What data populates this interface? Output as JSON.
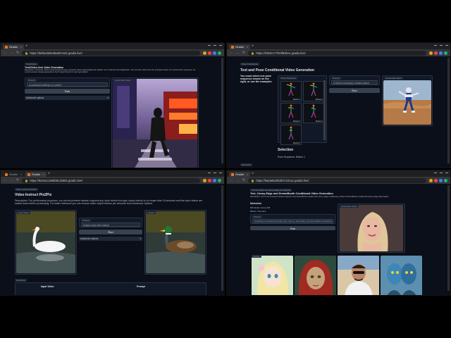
{
  "windows": [
    {
      "tab_title": "Gradio",
      "url": "https://daf5ed63ed0a567a23.gradio.live/",
      "app": {
        "tab": "Text2Video",
        "heading": "Text2Video-Zero Video Generation",
        "description": "Description: Generate videos using textual prompts, generate videos high-quality and realistic over continuity and imagination. You can also select from the examples below. For performance purposes, our current preview release generates only 8 output frames for each generation.",
        "prompt_label": "Prompt",
        "prompt_value": "an astronaut walking on a planet",
        "run_label": "Run",
        "advanced_label": "Advanced options",
        "output_label": "Generated Video"
      }
    },
    {
      "tab_title": "Gradio",
      "url": "https://2282cc77fe3f83bce.gradio.live/",
      "app": {
        "tab": "Pose Conditional",
        "heading": "Text and Pose Conditional Video Generation",
        "intro": "You must select one pose sequence shown on the right, or use the examples",
        "gallery_label": "Pose Sequence",
        "motions": [
          "Motion 1",
          "Motion 2",
          "Motion 3",
          "Motion 4",
          "Motion 5"
        ],
        "prompt_label": "Prompt",
        "prompt_value": "A Robot is dancing in Sahara desert",
        "run_label": "Run",
        "output_label": "Generated Video",
        "selection_heading": "Selection",
        "selection_value": "Pose Sequence: Motion 1",
        "examples_label": "Examples"
      }
    },
    {
      "tab_titles": [
        "Gradio",
        "Gradio"
      ],
      "url": "https://9244ccc59d08c18594.gradio.live/",
      "app": {
        "tab": "Video Instruct Pix2Pix",
        "heading": "Video Instruct Pix2Pix",
        "description": "Description: For performance purposes, our current preview release supports any input videos but caps output videos to no longer than 15 seconds and the input videos are scaled down before processing. For faster inference you can choose lower output frames per seconds from Advanced Options.",
        "input_label": "Input Video",
        "prompt_label": "Prompt",
        "prompt_value": "replace swan with mallard",
        "run_label": "Run",
        "advanced_label": "Advanced options",
        "output_label": "Output",
        "examples_label": "Examples",
        "examples_col1": "Input Video",
        "examples_col2": "Prompt"
      }
    },
    {
      "tab_title": "Gradio",
      "url": "https://8a0a6519b2b7cc01ac.gradio.live/",
      "app": {
        "tab": "Text Condition & Canny-Edge Conditional",
        "heading": "Text, Canny-Edge and DreamBooth Conditional Video Generation",
        "description": "Description: Our current preview release supports only DreamBooth models with canny-edge conditioning. Select a DreamBooth model and Canny edge video below.",
        "selection_heading": "Selection",
        "selection_lines": [
          "DB Model: Anime DB",
          "Motion: Woman1"
        ],
        "prompt_label": "Prompt",
        "prompt_value": "oil painting of a beautiful girl avatar style, close-up, ultra quality, extremely detailed, masterpiece",
        "run_label": "Run",
        "output_label": "Generated Video",
        "models_label": "Models"
      }
    }
  ],
  "colors": {
    "page_bg": "#0b0f19",
    "panel_bg": "#111827",
    "chrome_bar": "#35363a",
    "tab_strip": "#1f2023",
    "button": "#374151"
  },
  "icons": [
    "gradio-favicon",
    "lock-icon",
    "back-arrow-icon",
    "forward-arrow-icon",
    "reload-icon",
    "extension-icons"
  ]
}
